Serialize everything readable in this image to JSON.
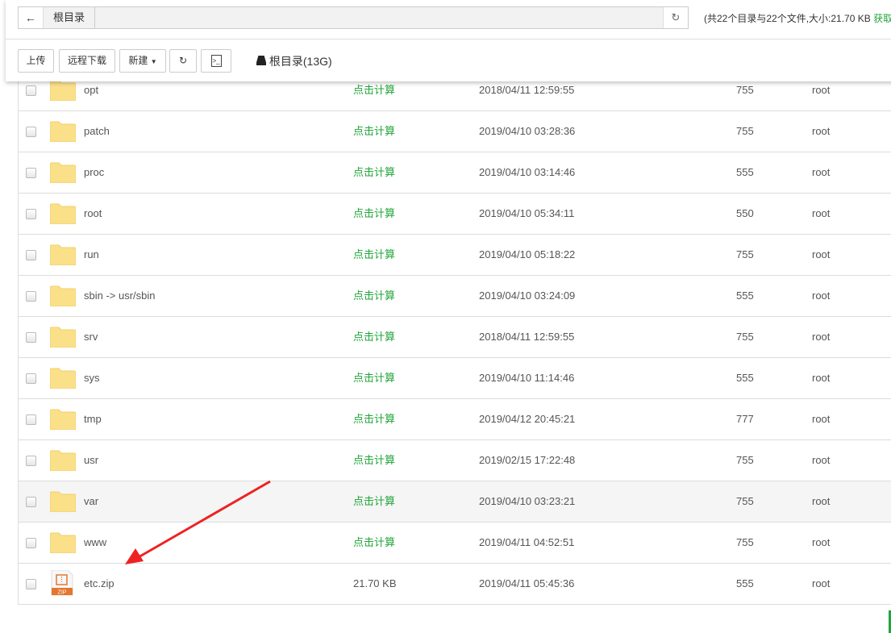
{
  "header": {
    "crumb": "根目录",
    "summary": "(共22个目录与22个文件,大小:21.70 KB ",
    "summary_link": "获取"
  },
  "toolbar": {
    "upload": "上传",
    "remote_download": "远程下载",
    "new": "新建",
    "disk": "根目录(13G)"
  },
  "rows": [
    {
      "name": "opt",
      "size": "点击计算",
      "date": "2018/04/11 12:59:55",
      "perm": "755",
      "owner": "root",
      "type": "folder"
    },
    {
      "name": "patch",
      "size": "点击计算",
      "date": "2019/04/10 03:28:36",
      "perm": "755",
      "owner": "root",
      "type": "folder"
    },
    {
      "name": "proc",
      "size": "点击计算",
      "date": "2019/04/10 03:14:46",
      "perm": "555",
      "owner": "root",
      "type": "folder"
    },
    {
      "name": "root",
      "size": "点击计算",
      "date": "2019/04/10 05:34:11",
      "perm": "550",
      "owner": "root",
      "type": "folder"
    },
    {
      "name": "run",
      "size": "点击计算",
      "date": "2019/04/10 05:18:22",
      "perm": "755",
      "owner": "root",
      "type": "folder"
    },
    {
      "name": "sbin -> usr/sbin",
      "size": "点击计算",
      "date": "2019/04/10 03:24:09",
      "perm": "555",
      "owner": "root",
      "type": "folder"
    },
    {
      "name": "srv",
      "size": "点击计算",
      "date": "2018/04/11 12:59:55",
      "perm": "755",
      "owner": "root",
      "type": "folder"
    },
    {
      "name": "sys",
      "size": "点击计算",
      "date": "2019/04/10 11:14:46",
      "perm": "555",
      "owner": "root",
      "type": "folder"
    },
    {
      "name": "tmp",
      "size": "点击计算",
      "date": "2019/04/12 20:45:21",
      "perm": "777",
      "owner": "root",
      "type": "folder"
    },
    {
      "name": "usr",
      "size": "点击计算",
      "date": "2019/02/15 17:22:48",
      "perm": "755",
      "owner": "root",
      "type": "folder"
    },
    {
      "name": "var",
      "size": "点击计算",
      "date": "2019/04/10 03:23:21",
      "perm": "755",
      "owner": "root",
      "type": "folder"
    },
    {
      "name": "www",
      "size": "点击计算",
      "date": "2019/04/11 04:52:51",
      "perm": "755",
      "owner": "root",
      "type": "folder"
    },
    {
      "name": "etc.zip",
      "size": "21.70 KB",
      "date": "2019/04/11 05:45:36",
      "perm": "555",
      "owner": "root",
      "type": "zip",
      "icon_label": "ZIP"
    }
  ],
  "colors": {
    "accent": "#20a53a",
    "arrow": "#ee2222",
    "folder": "#fbe08a",
    "zip": "#e4762f"
  }
}
